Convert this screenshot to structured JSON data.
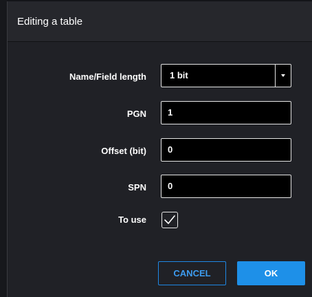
{
  "dialog": {
    "title": "Editing a table"
  },
  "form": {
    "name_field_length": {
      "label": "Name/Field length",
      "value": "1 bit"
    },
    "pgn": {
      "label": "PGN",
      "value": "1"
    },
    "offset_bit": {
      "label": "Offset (bit)",
      "value": "0"
    },
    "spn": {
      "label": "SPN",
      "value": "0"
    },
    "to_use": {
      "label": "To use",
      "checked": true
    }
  },
  "actions": {
    "cancel_label": "CANCEL",
    "ok_label": "OK"
  },
  "colors": {
    "accent": "#1e90e8",
    "dialog_bg": "#202126",
    "field_bg": "#000000"
  },
  "icons": {
    "dropdown": "caret-down-icon",
    "checkbox": "checkmark-icon"
  }
}
